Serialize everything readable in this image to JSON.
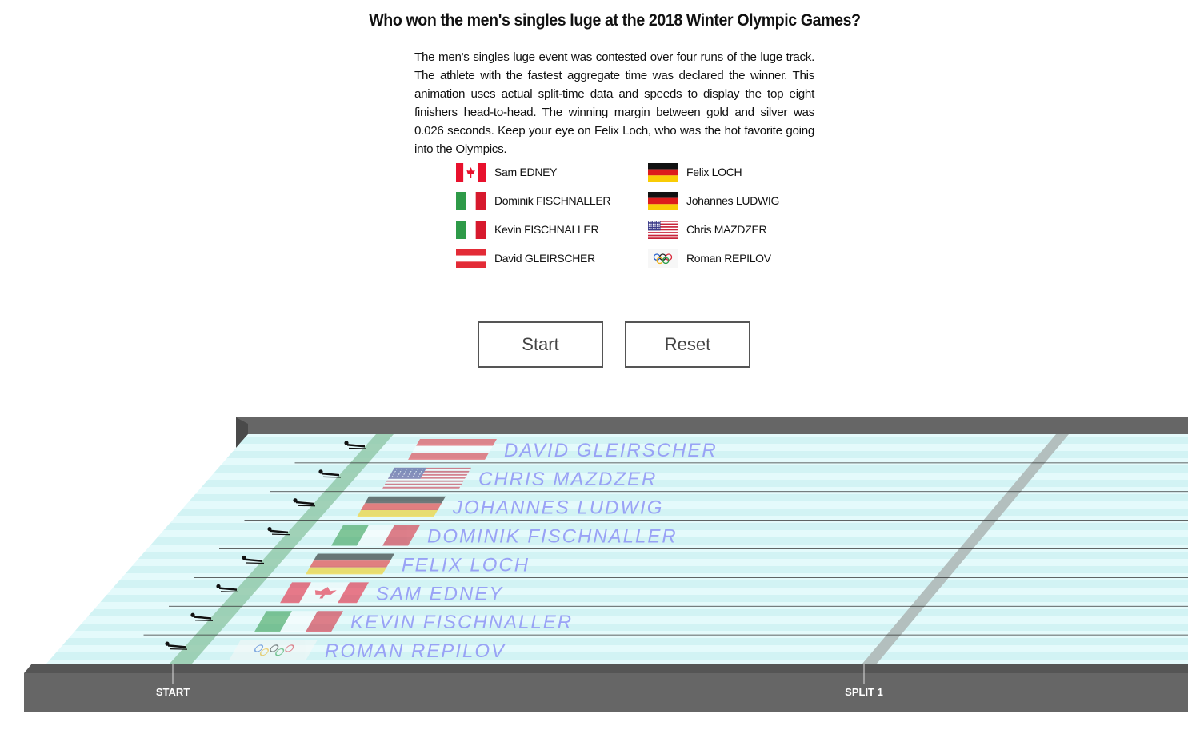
{
  "question": "Who won the men's singles luge at the 2018 Winter Olympic Games?",
  "intro": "The men's singles luge event was contested over four runs of the luge track. The athlete with the fastest aggregate time was declared the winner. This animation uses actual split-time data and speeds to display the top eight finishers head-to-head. The winning margin between gold and silver was 0.026 seconds. Keep your eye on Felix Loch, who was the hot favorite going into the Olympics.",
  "legend": [
    {
      "name": "Sam EDNEY",
      "flag": "canada"
    },
    {
      "name": "Dominik FISCHNALLER",
      "flag": "italy"
    },
    {
      "name": "Kevin FISCHNALLER",
      "flag": "italy"
    },
    {
      "name": "David GLEIRSCHER",
      "flag": "austria"
    },
    {
      "name": "Felix LOCH",
      "flag": "germany"
    },
    {
      "name": "Johannes LUDWIG",
      "flag": "germany"
    },
    {
      "name": "Chris MAZDZER",
      "flag": "usa"
    },
    {
      "name": "Roman REPILOV",
      "flag": "olympic"
    }
  ],
  "buttons": {
    "start": "Start",
    "reset": "Reset"
  },
  "lanes": [
    {
      "name": "DAVID GLEIRSCHER",
      "flag": "austria"
    },
    {
      "name": "CHRIS MAZDZER",
      "flag": "usa"
    },
    {
      "name": "JOHANNES LUDWIG",
      "flag": "germany"
    },
    {
      "name": "DOMINIK FISCHNALLER",
      "flag": "italy"
    },
    {
      "name": "FELIX LOCH",
      "flag": "germany"
    },
    {
      "name": "SAM EDNEY",
      "flag": "canada"
    },
    {
      "name": "KEVIN FISCHNALLER",
      "flag": "italy"
    },
    {
      "name": "ROMAN REPILOV",
      "flag": "olympic"
    }
  ],
  "markers": {
    "start": "START",
    "split1": "SPLIT 1"
  },
  "colors": {
    "track_ice": "#e4fafb",
    "track_stripe": "#cdf1f3",
    "wall": "#666666",
    "start_line": "#8fc7a6",
    "split_line": "#b3bfbe",
    "name_text": "#8d93f5"
  }
}
